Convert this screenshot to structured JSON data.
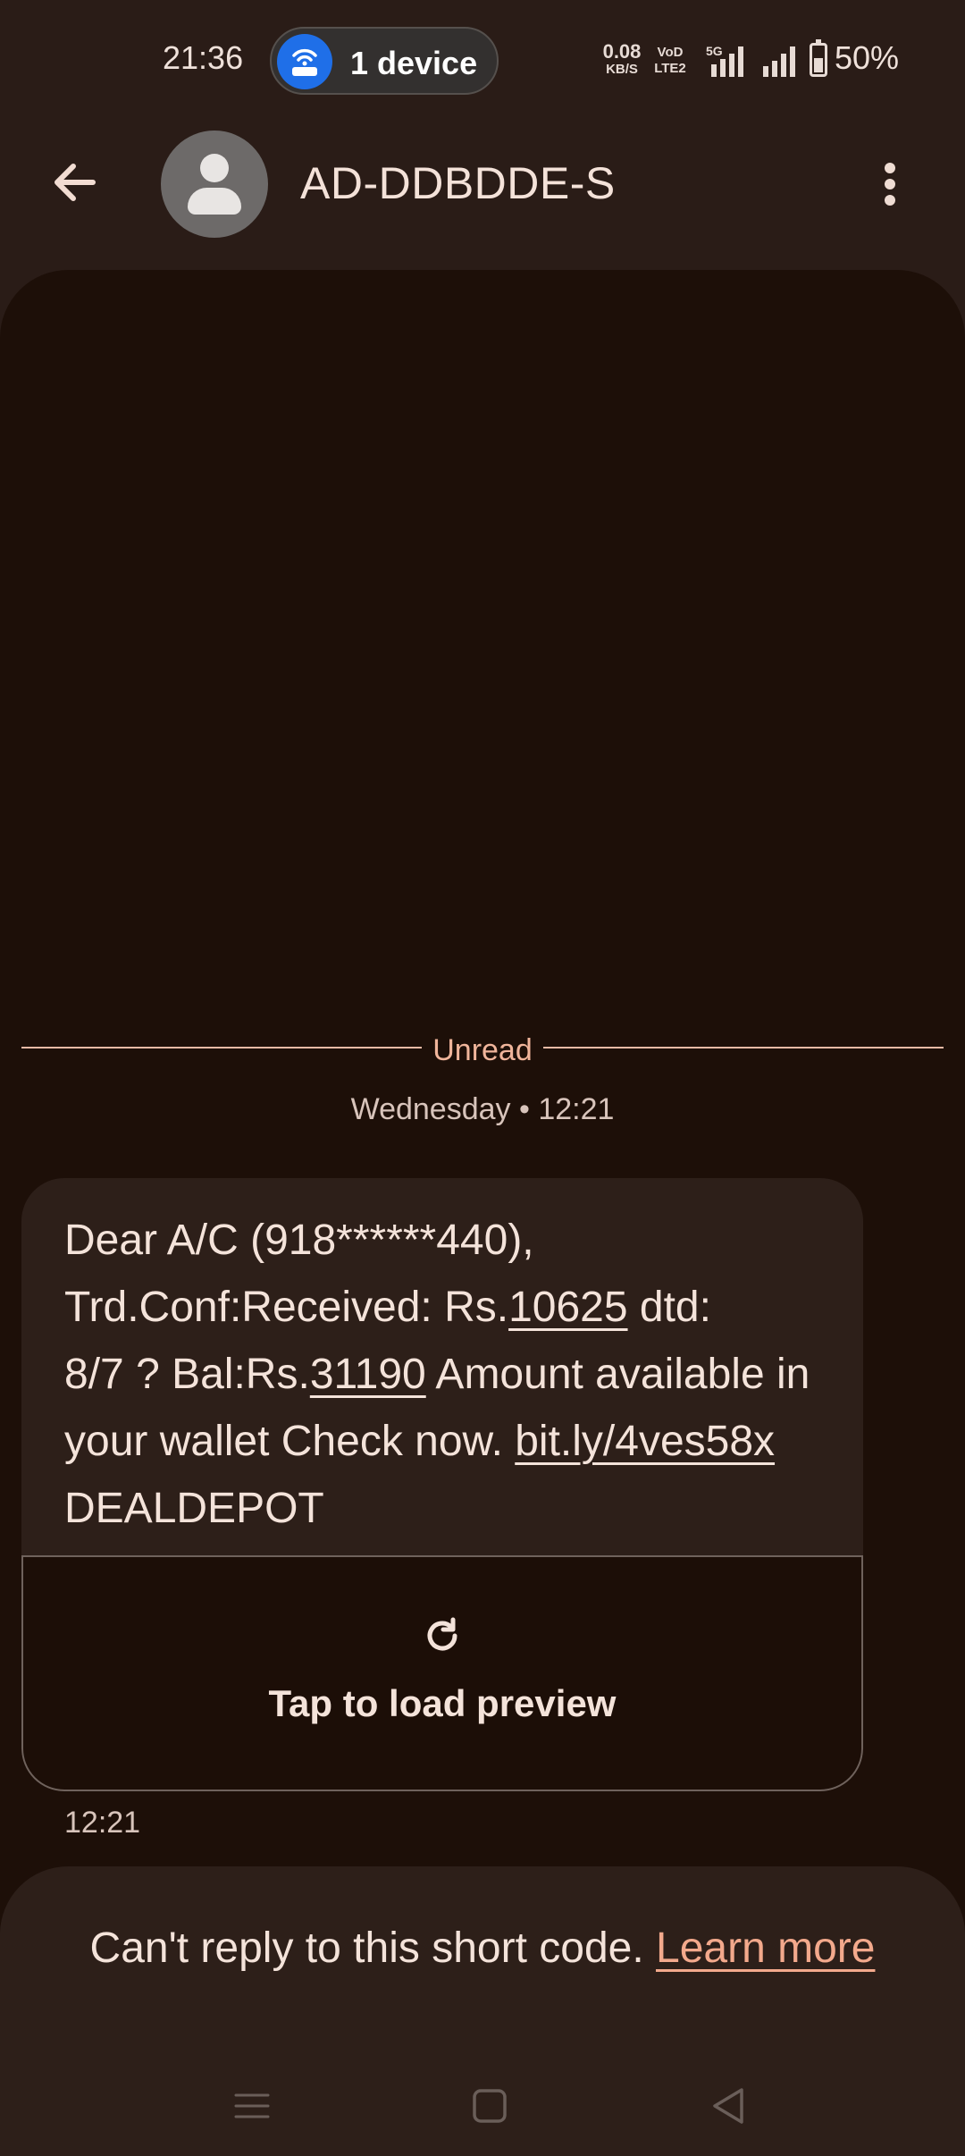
{
  "status_bar": {
    "time": "21:36",
    "hotspot_label": "1 device",
    "net_speed_value": "0.08",
    "net_speed_unit": "KB/S",
    "volte_top": "VoD",
    "volte_bottom": "LTE2",
    "network_type": "5G",
    "battery_percent": "50%",
    "battery_level": 0.5
  },
  "app_bar": {
    "contact_name": "AD-DDBDDE-S"
  },
  "conversation": {
    "unread_label": "Unread",
    "day_stamp": "Wednesday • 12:21",
    "message": {
      "lines": [
        [
          "Dear A/C (918******440),"
        ],
        [
          "Trd.Conf:Received: Rs.",
          "10625",
          " dtd:"
        ],
        [
          "8/7 ? Bal:Rs.",
          "31190",
          " Amount available in"
        ],
        [
          "your wallet Check now. ",
          "bit.ly/4ves58x"
        ],
        [
          "DEALDEPOT"
        ]
      ],
      "preview_label": "Tap to load preview",
      "time": "12:21"
    }
  },
  "reply_notice": {
    "text": "Can't reply to this short code. ",
    "link_label": "Learn more"
  },
  "colors": {
    "background": "#2a1c17",
    "conversation_bg": "#1d0f08",
    "bubble": "#2d1f19",
    "accent": "#f3a98c",
    "hotspot_blue": "#1f6fe8"
  },
  "icons": {
    "hotspot": "hotspot-router-icon",
    "back": "arrow-left-icon",
    "avatar": "person-icon",
    "more": "more-vert-icon",
    "refresh": "refresh-icon",
    "nav_menu": "menu-icon",
    "nav_home": "home-square-icon",
    "nav_back": "back-triangle-icon"
  }
}
